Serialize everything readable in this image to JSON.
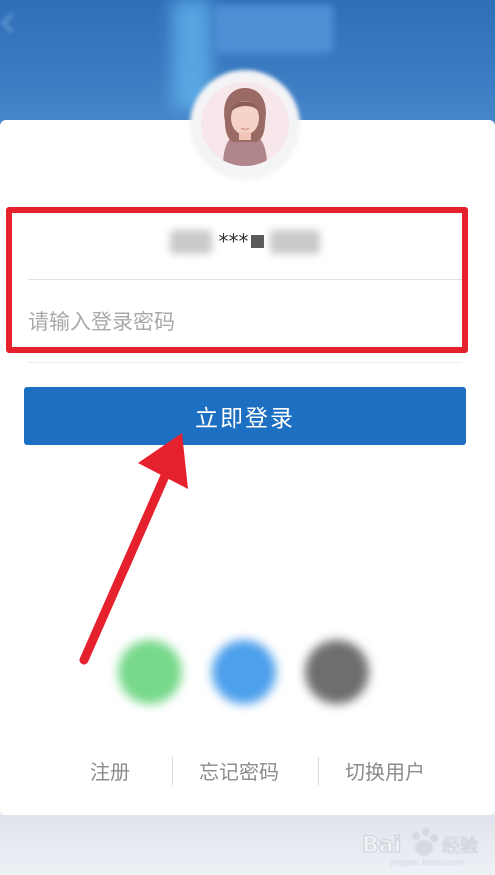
{
  "account": {
    "masked_middle": "***"
  },
  "password": {
    "placeholder": "请输入登录密码",
    "value": ""
  },
  "login_button": {
    "label": "立即登录"
  },
  "social_logins": [
    "green-circle",
    "blue-circle",
    "gray-circle"
  ],
  "footer_links": {
    "register": "注册",
    "forgot_password": "忘记密码",
    "switch_user": "切换用户"
  },
  "colors": {
    "primary": "#1d6fc1",
    "highlight_red": "#e6212e",
    "header_blue": "#3c7cc3"
  },
  "watermark_text": "Bai 经验"
}
